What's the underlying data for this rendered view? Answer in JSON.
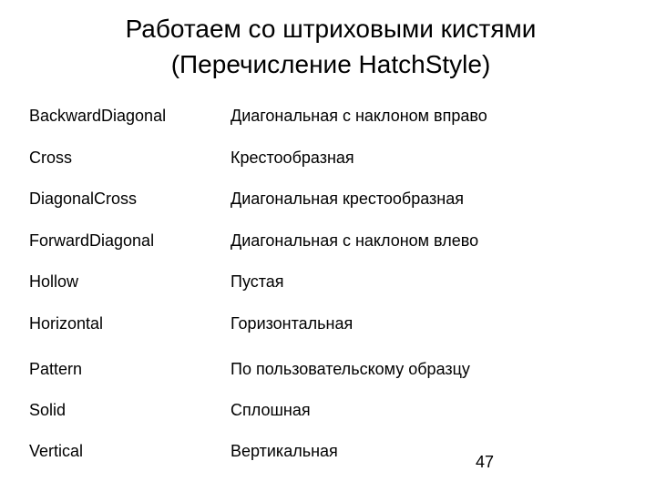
{
  "slide": {
    "title_line1": "Работаем со штриховыми кистями",
    "title_line2": "(Перечисление HatchStyle)",
    "rows": [
      {
        "term": "BackwardDiagonal",
        "description": "Диагональная с наклоном вправо"
      },
      {
        "term": "Cross",
        "description": "Крестообразная"
      },
      {
        "term": "DiagonalCross",
        "description": "Диагональная крестообразная"
      },
      {
        "term": "ForwardDiagonal",
        "description": "Диагональная с наклоном влево"
      },
      {
        "term": "Hollow",
        "description": "Пустая"
      },
      {
        "term": "Horizontal",
        "description": "Горизонтальная"
      },
      {
        "term": "Pattern",
        "description": "По пользовательскому образцу"
      },
      {
        "term": "Solid",
        "description": "Сплошная"
      },
      {
        "term": "Vertical",
        "description": "Вертикальная"
      }
    ],
    "page_number": "47"
  }
}
